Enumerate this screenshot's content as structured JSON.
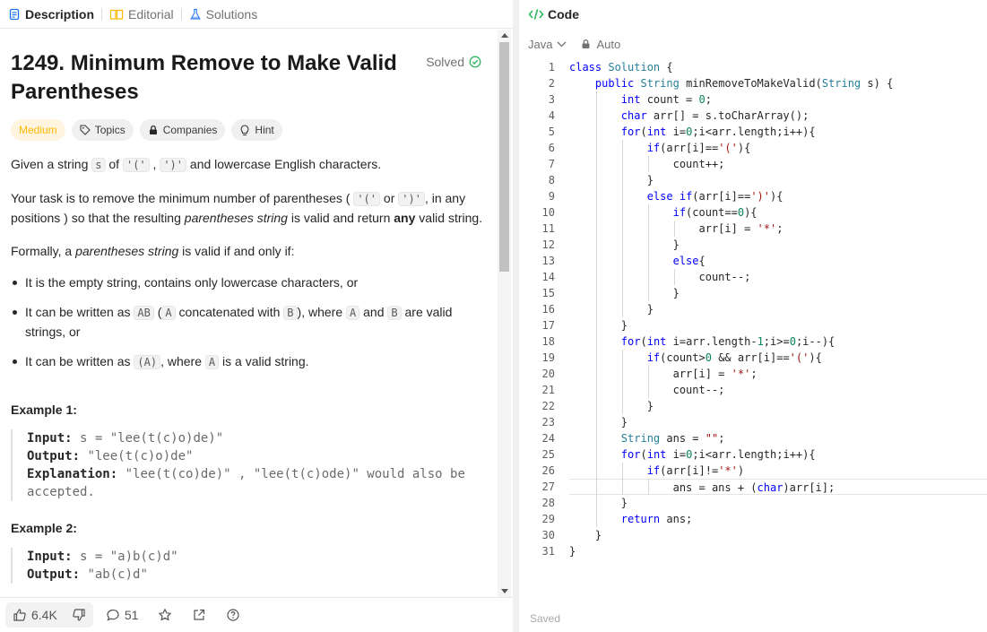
{
  "tabs": {
    "description": "Description",
    "editorial": "Editorial",
    "solutions": "Solutions"
  },
  "problem": {
    "title_line1": "1249. Minimum Remove to Make Valid",
    "title_line2": "Parentheses",
    "solved": "Solved",
    "difficulty": "Medium",
    "chips": {
      "topics": "Topics",
      "companies": "Companies",
      "hint": "Hint"
    },
    "p1_a": "Given a string ",
    "p1_s": "s",
    "p1_b": " of ",
    "p1_c1": "'('",
    "p1_comma": " , ",
    "p1_c2": "')'",
    "p1_c": " and lowercase English characters.",
    "p2_a": "Your task is to remove the minimum number of parentheses ( ",
    "p2_c1": "'('",
    "p2_or": " or ",
    "p2_c2": "')'",
    "p2_b": ", in any positions ) so that the resulting ",
    "p2_em": "parentheses string",
    "p2_c": " is valid and return ",
    "p2_any": "any",
    "p2_d": " valid string.",
    "p3_a": "Formally, a ",
    "p3_em": "parentheses string",
    "p3_b": " is valid if and only if:",
    "b1": "It is the empty string, contains only lowercase characters, or",
    "b2_a": "It can be written as ",
    "b2_AB": "AB",
    "b2_b": " (",
    "b2_A": "A",
    "b2_c": " concatenated with ",
    "b2_B": "B",
    "b2_d": "), where ",
    "b2_A2": "A",
    "b2_and": " and ",
    "b2_B2": "B",
    "b2_e": " are valid strings, or",
    "b3_a": "It can be written as ",
    "b3_code": "(A)",
    "b3_b": ", where ",
    "b3_A": "A",
    "b3_c": " is a valid string.",
    "ex1_title": "Example 1:",
    "ex1_in_label": "Input:",
    "ex1_in": " s = \"lee(t(c)o)de)\"",
    "ex1_out_label": "Output:",
    "ex1_out": " \"lee(t(c)o)de\"",
    "ex1_exp_label": "Explanation:",
    "ex1_exp1": " \"lee(t(co)de)\" , \"lee(t(c)ode)\" would also be",
    "ex1_exp2": "accepted.",
    "ex2_title": "Example 2:",
    "ex2_in_label": "Input:",
    "ex2_in": " s = \"a)b(c)d\"",
    "ex2_out_label": "Output:",
    "ex2_out": " \"ab(c)d\""
  },
  "footer": {
    "likes": "6.4K",
    "comments": "51"
  },
  "editor": {
    "tab": "Code",
    "language": "Java",
    "auto": "Auto",
    "status": "Saved",
    "line_numbers": [
      "1",
      "2",
      "3",
      "4",
      "5",
      "6",
      "7",
      "8",
      "9",
      "10",
      "11",
      "12",
      "13",
      "14",
      "15",
      "16",
      "17",
      "18",
      "19",
      "20",
      "21",
      "22",
      "23",
      "24",
      "25",
      "26",
      "27",
      "28",
      "29",
      "30",
      "31"
    ],
    "code_lines": [
      "class Solution {",
      "    public String minRemoveToMakeValid(String s) {",
      "        int count = 0;",
      "        char arr[] = s.toCharArray();",
      "        for(int i=0;i<arr.length;i++){",
      "            if(arr[i]=='('){",
      "                count++;",
      "            }",
      "            else if(arr[i]==')'){",
      "                if(count==0){",
      "                    arr[i] = '*';",
      "                }",
      "                else{",
      "                    count--;",
      "                }",
      "            }",
      "        }",
      "        for(int i=arr.length-1;i>=0;i--){",
      "            if(count>0 && arr[i]=='('){",
      "                arr[i] = '*';",
      "                count--;",
      "            }",
      "        }",
      "        String ans = \"\";",
      "        for(int i=0;i<arr.length;i++){",
      "            if(arr[i]!='*')",
      "                ans = ans + (char)arr[i];",
      "        }",
      "        return ans;",
      "    }",
      "}"
    ],
    "current_line": 27
  },
  "colors": {
    "medium": "#ffb800",
    "solved": "#2db55d",
    "keyword": "#0000ff",
    "type": "#267f99",
    "string": "#a31515",
    "number": "#098658"
  }
}
